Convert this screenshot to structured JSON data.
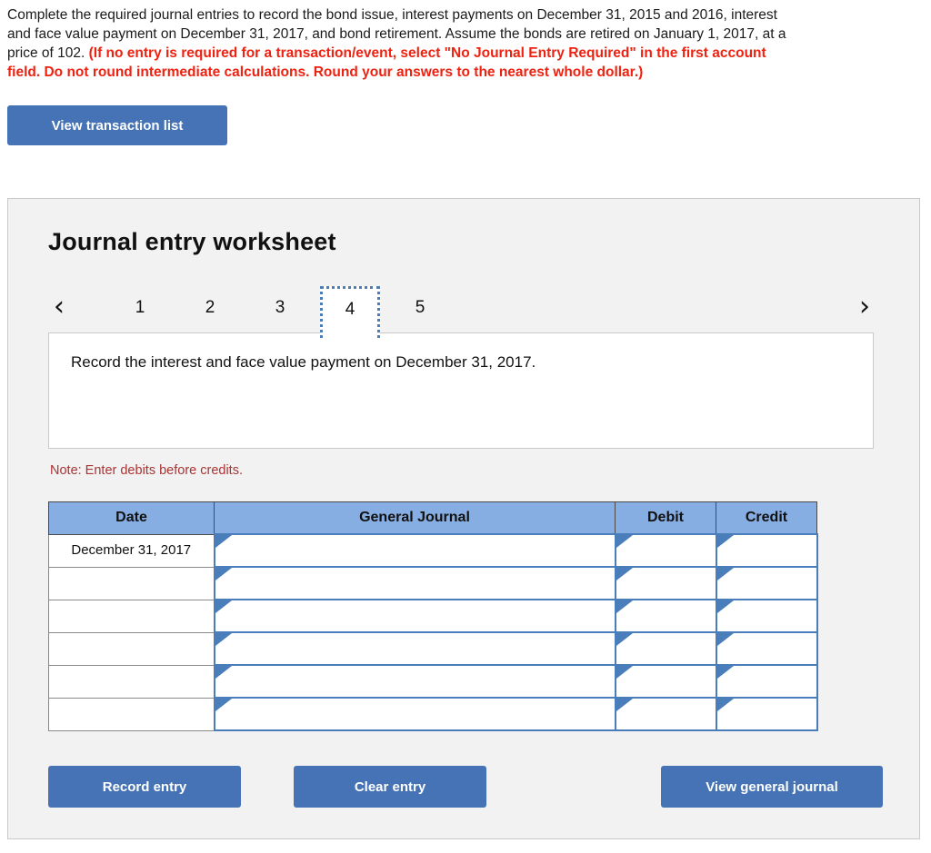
{
  "prompt": {
    "black_part": "Complete the required journal entries to record the bond issue, interest payments on December 31, 2015 and 2016, interest and face value payment on December 31, 2017, and bond retirement. Assume the bonds are retired on January 1, 2017, at a price of 102. ",
    "red_part": "(If no entry is required for a transaction/event, select \"No Journal Entry Required\" in the first account field. Do not round intermediate calculations. Round your answers to the nearest whole dollar.)"
  },
  "toolbar": {
    "view_transaction_list_label": "View transaction list"
  },
  "worksheet": {
    "title": "Journal entry worksheet",
    "pager": {
      "prev_icon": "chevron-left-icon",
      "next_icon": "chevron-right-icon",
      "prev_glyph": "‹",
      "next_glyph": "›",
      "tabs": [
        {
          "label": "1",
          "active": false
        },
        {
          "label": "2",
          "active": false
        },
        {
          "label": "3",
          "active": false
        },
        {
          "label": "4",
          "active": true
        },
        {
          "label": "5",
          "active": false
        }
      ],
      "active_tab": "4"
    },
    "instruction": "Record the interest and face value payment on December 31, 2017.",
    "note": "Note: Enter debits before credits.",
    "table": {
      "columns": [
        "Date",
        "General Journal",
        "Debit",
        "Credit"
      ],
      "rows": [
        {
          "date": "December 31, 2017",
          "general_journal": "",
          "debit": "",
          "credit": ""
        },
        {
          "date": "",
          "general_journal": "",
          "debit": "",
          "credit": ""
        },
        {
          "date": "",
          "general_journal": "",
          "debit": "",
          "credit": ""
        },
        {
          "date": "",
          "general_journal": "",
          "debit": "",
          "credit": ""
        },
        {
          "date": "",
          "general_journal": "",
          "debit": "",
          "credit": ""
        },
        {
          "date": "",
          "general_journal": "",
          "debit": "",
          "credit": ""
        }
      ]
    },
    "actions": {
      "record_entry_label": "Record entry",
      "clear_entry_label": "Clear entry",
      "view_general_journal_label": "View general journal"
    }
  },
  "colors": {
    "accent_blue": "#4573b5",
    "table_header_blue": "#86aee2",
    "cell_border_blue": "#4a7ebb",
    "alert_red": "#ee2211",
    "note_red": "#a33333",
    "panel_bg": "#f2f2f2"
  }
}
